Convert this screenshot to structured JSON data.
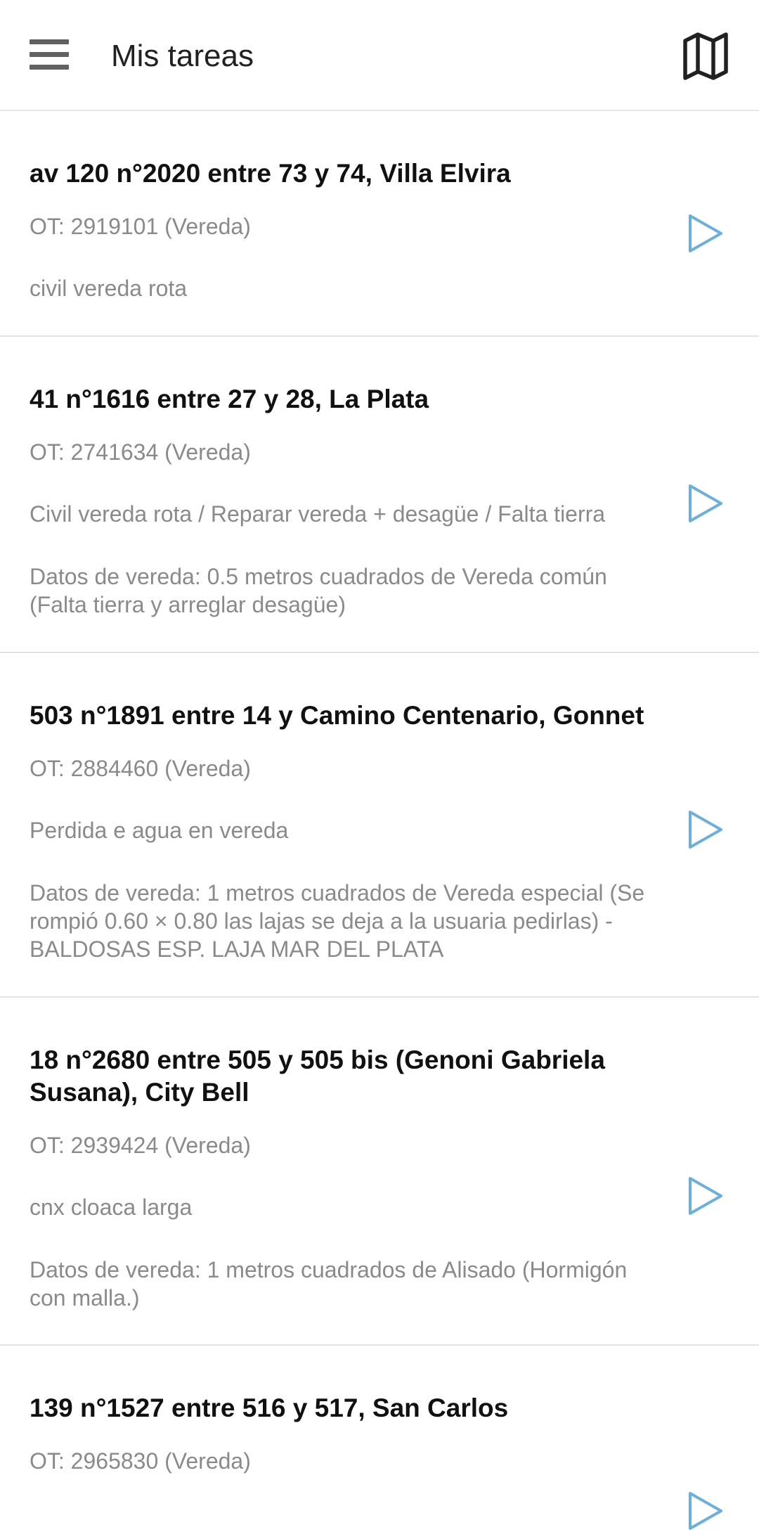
{
  "header": {
    "title": "Mis tareas",
    "menu_icon": "hamburger-menu-icon",
    "map_icon": "map-icon"
  },
  "accent_color": "#6ab0de",
  "tasks": [
    {
      "address": "av 120 n°2020 entre 73 y 74, Villa Elvira",
      "ot": "OT: 2919101 (Vereda)",
      "description": "civil vereda rota",
      "details": ""
    },
    {
      "address": "41 n°1616 entre 27 y 28, La Plata",
      "ot": "OT: 2741634 (Vereda)",
      "description": "Civil vereda rota / Reparar vereda + desagüe / Falta tierra",
      "details": "Datos de vereda: 0.5 metros cuadrados de Vereda común (Falta tierra y arreglar desagüe)"
    },
    {
      "address": "503 n°1891 entre 14 y Camino Centenario, Gonnet",
      "ot": "OT: 2884460 (Vereda)",
      "description": "Perdida e agua en vereda",
      "details": "Datos de vereda: 1 metros cuadrados de Vereda especial (Se rompió 0.60 × 0.80 las lajas se deja a la usuaria pedirlas) - BALDOSAS ESP. LAJA MAR DEL PLATA"
    },
    {
      "address": "18 n°2680 entre 505 y 505 bis (Genoni Gabriela Susana), City Bell",
      "ot": "OT: 2939424 (Vereda)",
      "description": "cnx cloaca larga",
      "details": "Datos de vereda: 1 metros cuadrados de Alisado (Hormigón con malla.)"
    },
    {
      "address": "139 n°1527 entre 516 y 517, San Carlos",
      "ot": "OT: 2965830 (Vereda)",
      "description": "",
      "details": ""
    }
  ]
}
